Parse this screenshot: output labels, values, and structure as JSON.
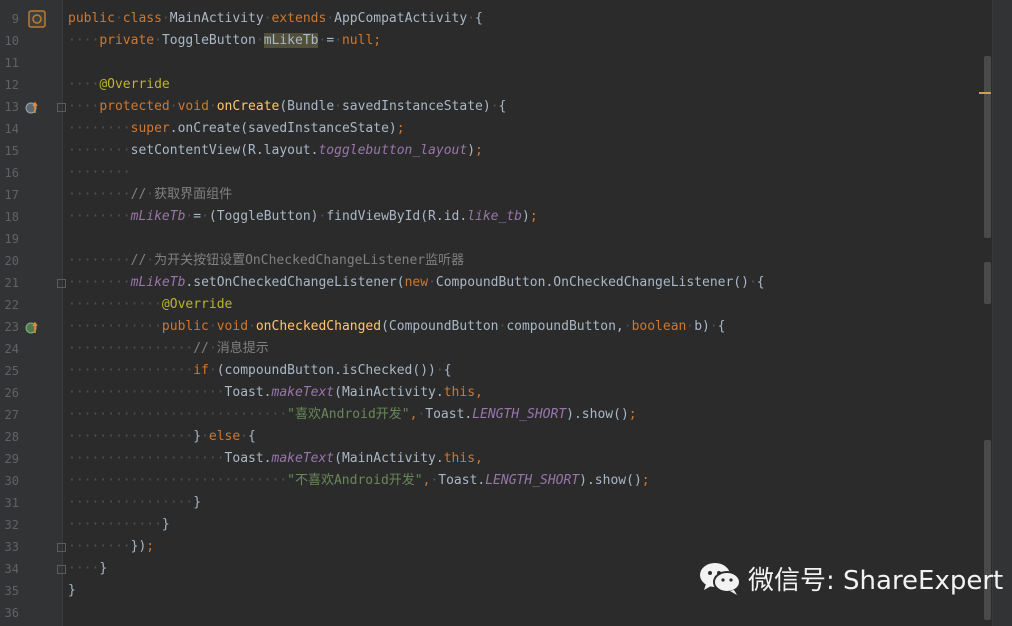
{
  "colors": {
    "background": "#2b2b2b",
    "gutter": "#313335",
    "keyword": "#cc7832",
    "method": "#ffc66d",
    "annotation": "#bbb529",
    "field": "#9876aa",
    "string": "#6a8759",
    "comment": "#808080",
    "text": "#a9b7c6"
  },
  "editor": {
    "lines": [
      {
        "num": "9",
        "indent": "",
        "tokens": [
          [
            "kw",
            "public"
          ],
          [
            "ws",
            "·"
          ],
          [
            "kw",
            "class"
          ],
          [
            "ws",
            "·"
          ],
          [
            "tx",
            "MainActivity"
          ],
          [
            "ws",
            "·"
          ],
          [
            "kw",
            "extends"
          ],
          [
            "ws",
            "·"
          ],
          [
            "tx",
            "AppCompatActivity"
          ],
          [
            "ws",
            "·"
          ],
          [
            "tx",
            "{"
          ]
        ]
      },
      {
        "num": "10",
        "indent": "····",
        "tokens": [
          [
            "kw",
            "private"
          ],
          [
            "ws",
            "·"
          ],
          [
            "tx",
            "ToggleButton"
          ],
          [
            "ws",
            "·"
          ],
          [
            "hl",
            "mLikeTb"
          ],
          [
            "ws",
            "·"
          ],
          [
            "tx",
            "="
          ],
          [
            "ws",
            "·"
          ],
          [
            "kw",
            "null"
          ],
          [
            "kw",
            ";"
          ]
        ]
      },
      {
        "num": "11",
        "indent": "",
        "tokens": []
      },
      {
        "num": "12",
        "indent": "····",
        "tokens": [
          [
            "an",
            "@Override"
          ]
        ]
      },
      {
        "num": "13",
        "indent": "····",
        "tokens": [
          [
            "kw",
            "protected"
          ],
          [
            "ws",
            "·"
          ],
          [
            "kw",
            "void"
          ],
          [
            "ws",
            "·"
          ],
          [
            "fn",
            "onCreate"
          ],
          [
            "tx",
            "(Bundle"
          ],
          [
            "ws",
            "·"
          ],
          [
            "tx",
            "savedInstanceState)"
          ],
          [
            "ws",
            "·"
          ],
          [
            "tx",
            "{"
          ]
        ]
      },
      {
        "num": "14",
        "indent": "········",
        "tokens": [
          [
            "kw",
            "super"
          ],
          [
            "tx",
            "."
          ],
          [
            "tx",
            "onCreate(savedInstanceState)"
          ],
          [
            "kw",
            ";"
          ]
        ]
      },
      {
        "num": "15",
        "indent": "········",
        "tokens": [
          [
            "tx",
            "setContentView(R.layout."
          ],
          [
            "it",
            "togglebutton_layout"
          ],
          [
            "tx",
            ")"
          ],
          [
            "kw",
            ";"
          ]
        ]
      },
      {
        "num": "16",
        "indent": "········",
        "tokens": []
      },
      {
        "num": "17",
        "indent": "········",
        "tokens": [
          [
            "cm",
            "//"
          ],
          [
            "ws",
            "·"
          ],
          [
            "cm",
            "获取界面组件"
          ]
        ]
      },
      {
        "num": "18",
        "indent": "········",
        "tokens": [
          [
            "it",
            "mLikeTb"
          ],
          [
            "ws",
            "·"
          ],
          [
            "tx",
            "="
          ],
          [
            "ws",
            "·"
          ],
          [
            "tx",
            "(ToggleButton)"
          ],
          [
            "ws",
            "·"
          ],
          [
            "tx",
            "findViewById(R.id."
          ],
          [
            "it",
            "like_tb"
          ],
          [
            "tx",
            ")"
          ],
          [
            "kw",
            ";"
          ]
        ]
      },
      {
        "num": "19",
        "indent": "",
        "tokens": []
      },
      {
        "num": "20",
        "indent": "········",
        "tokens": [
          [
            "cm",
            "//"
          ],
          [
            "ws",
            "·"
          ],
          [
            "cm",
            "为开关按钮设置OnCheckedChangeListener监听器"
          ]
        ]
      },
      {
        "num": "21",
        "indent": "········",
        "tokens": [
          [
            "it",
            "mLikeTb"
          ],
          [
            "tx",
            ".setOnCheckedChangeListener("
          ],
          [
            "kw",
            "new"
          ],
          [
            "ws",
            "·"
          ],
          [
            "tx",
            "CompoundButton.OnCheckedChangeListener()"
          ],
          [
            "ws",
            "·"
          ],
          [
            "tx",
            "{"
          ]
        ]
      },
      {
        "num": "22",
        "indent": "············",
        "tokens": [
          [
            "an",
            "@Override"
          ]
        ]
      },
      {
        "num": "23",
        "indent": "············",
        "tokens": [
          [
            "kw",
            "public"
          ],
          [
            "ws",
            "·"
          ],
          [
            "kw",
            "void"
          ],
          [
            "ws",
            "·"
          ],
          [
            "fn",
            "onCheckedChanged"
          ],
          [
            "tx",
            "(CompoundButton"
          ],
          [
            "ws",
            "·"
          ],
          [
            "tx",
            "compoundButton,"
          ],
          [
            "ws",
            "·"
          ],
          [
            "kw",
            "boolean"
          ],
          [
            "ws",
            "·"
          ],
          [
            "tx",
            "b)"
          ],
          [
            "ws",
            "·"
          ],
          [
            "tx",
            "{"
          ]
        ]
      },
      {
        "num": "24",
        "indent": "················",
        "tokens": [
          [
            "cm",
            "//"
          ],
          [
            "ws",
            "·"
          ],
          [
            "cm",
            "消息提示"
          ]
        ]
      },
      {
        "num": "25",
        "indent": "················",
        "tokens": [
          [
            "kw",
            "if"
          ],
          [
            "ws",
            "·"
          ],
          [
            "tx",
            "(compoundButton.isChecked())"
          ],
          [
            "ws",
            "·"
          ],
          [
            "tx",
            "{"
          ]
        ]
      },
      {
        "num": "26",
        "indent": "····················",
        "tokens": [
          [
            "tx",
            "Toast."
          ],
          [
            "it2",
            "makeText"
          ],
          [
            "tx",
            "(MainActivity."
          ],
          [
            "kw",
            "this"
          ],
          [
            "kw",
            ","
          ]
        ]
      },
      {
        "num": "27",
        "indent": "····························",
        "tokens": [
          [
            "st",
            "\"喜欢Android开发\""
          ],
          [
            "kw",
            ","
          ],
          [
            "ws",
            "·"
          ],
          [
            "tx",
            "Toast."
          ],
          [
            "it",
            "LENGTH_SHORT"
          ],
          [
            "tx",
            ").show()"
          ],
          [
            "kw",
            ";"
          ]
        ]
      },
      {
        "num": "28",
        "indent": "················",
        "tokens": [
          [
            "tx",
            "}"
          ],
          [
            "ws",
            "·"
          ],
          [
            "kw",
            "else"
          ],
          [
            "ws",
            "·"
          ],
          [
            "tx",
            "{"
          ]
        ]
      },
      {
        "num": "29",
        "indent": "····················",
        "tokens": [
          [
            "tx",
            "Toast."
          ],
          [
            "it2",
            "makeText"
          ],
          [
            "tx",
            "(MainActivity."
          ],
          [
            "kw",
            "this"
          ],
          [
            "kw",
            ","
          ]
        ]
      },
      {
        "num": "30",
        "indent": "····························",
        "tokens": [
          [
            "st",
            "\"不喜欢Android开发\""
          ],
          [
            "kw",
            ","
          ],
          [
            "ws",
            "·"
          ],
          [
            "tx",
            "Toast."
          ],
          [
            "it",
            "LENGTH_SHORT"
          ],
          [
            "tx",
            ").show()"
          ],
          [
            "kw",
            ";"
          ]
        ]
      },
      {
        "num": "31",
        "indent": "················",
        "tokens": [
          [
            "tx",
            "}"
          ]
        ]
      },
      {
        "num": "32",
        "indent": "············",
        "tokens": [
          [
            "tx",
            "}"
          ]
        ]
      },
      {
        "num": "33",
        "indent": "········",
        "tokens": [
          [
            "tx",
            "})"
          ],
          [
            "kw",
            ";"
          ]
        ]
      },
      {
        "num": "34",
        "indent": "····",
        "tokens": [
          [
            "tx",
            "}"
          ]
        ]
      },
      {
        "num": "35",
        "indent": "",
        "tokens": [
          [
            "tx",
            "}"
          ]
        ]
      },
      {
        "num": "36",
        "indent": "",
        "tokens": []
      }
    ]
  },
  "gutter_icons": {
    "class_icon": "class-run-icon",
    "override_icon_1": "override-method-icon",
    "override_icon_2": "implement-method-icon"
  },
  "watermark": {
    "text": "微信号: ShareExpert",
    "icon": "wechat-icon"
  }
}
